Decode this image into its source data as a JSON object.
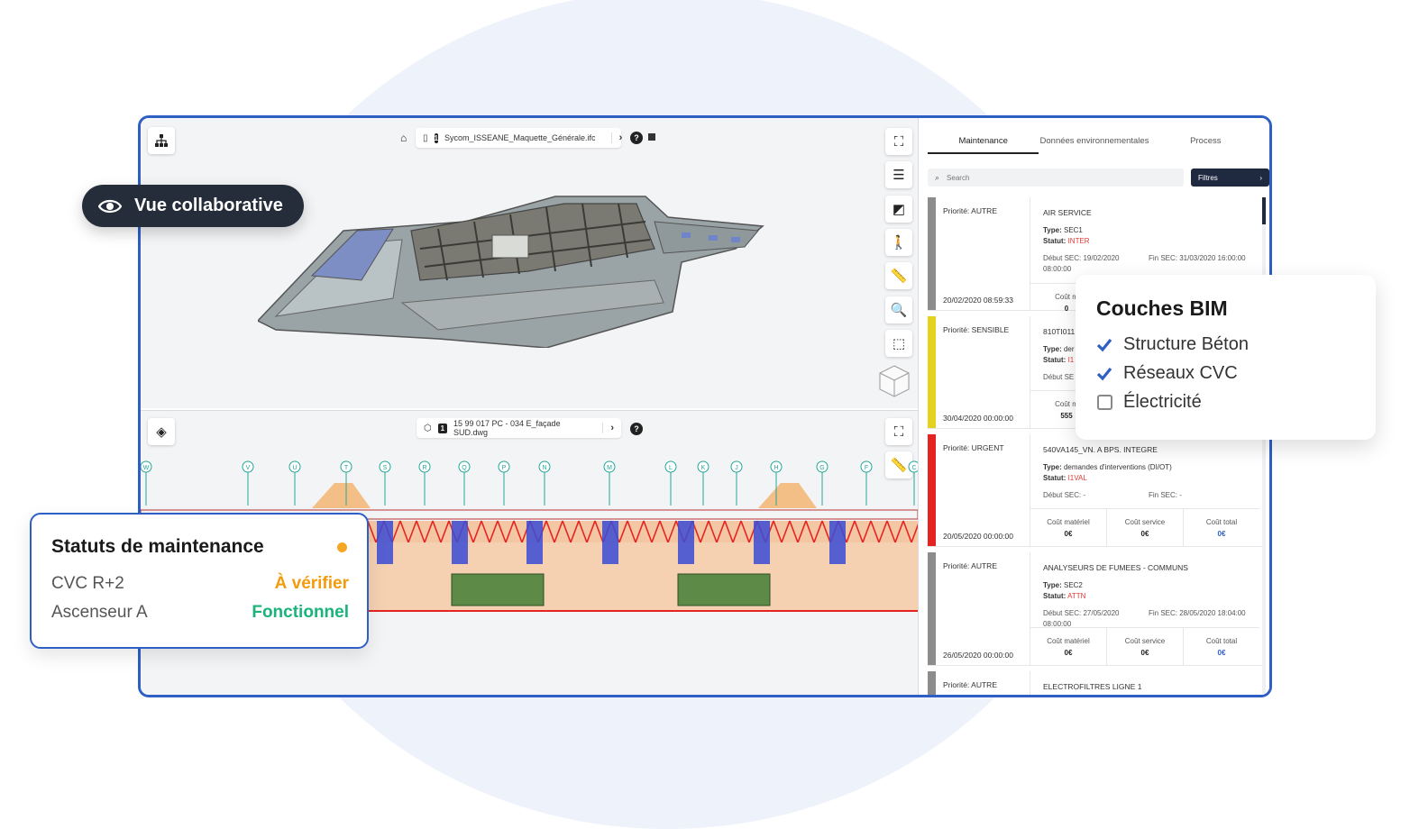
{
  "top_viewer": {
    "file_index": "1",
    "file_name": "Sycom_ISSEANE_Maquette_Générale.ifc",
    "help": "?"
  },
  "bottom_viewer": {
    "file_index": "1",
    "file_name": "15 99 017 PC - 034 E_façade SUD.dwg",
    "help": "?",
    "grid_markers": [
      "W",
      "V",
      "U",
      "T",
      "S",
      "R",
      "Q",
      "P",
      "N",
      "M",
      "L",
      "K",
      "J",
      "H",
      "G",
      "F",
      "C"
    ]
  },
  "tabs": [
    "Maintenance",
    "Données environnementales",
    "Process"
  ],
  "search": {
    "placeholder": "Search"
  },
  "filters_label": "Filtres",
  "cards": [
    {
      "bar_color": "#8c8c8c",
      "priority": "Priorité: AUTRE",
      "date": "20/02/2020 08:59:33",
      "title": "AIR SERVICE",
      "type_label": "Type:",
      "type": "SEC1",
      "status_label": "Statut:",
      "status": "INTER",
      "debut": "Début SEC: 19/02/2020 08:00:00",
      "fin": "Fin SEC: 31/03/2020 16:00:00",
      "cost_mat_label": "Coût m",
      "cost_mat": "0"
    },
    {
      "bar_color": "#e5d21e",
      "priority": "Priorité: SENSIBLE",
      "date": "30/04/2020 00:00:00",
      "title": "810TI011",
      "type_label": "Type:",
      "type": "der",
      "status_label": "Statut:",
      "status": "I1",
      "debut": "Début SE",
      "cost_mat_label": "Coût m",
      "cost_mat": "555"
    },
    {
      "bar_color": "#e52321",
      "priority": "Priorité: URGENT",
      "date": "20/05/2020 00:00:00",
      "title": "540VA145_VN. A BPS. INTEGRE",
      "type_label": "Type:",
      "type": "demandes d'interventions (DI/OT)",
      "status_label": "Statut:",
      "status": "I1VAL",
      "debut": "Début SEC: -",
      "fin": "Fin SEC: -",
      "cost_mat_label": "Coût matériel",
      "cost_mat": "0€",
      "cost_serv_label": "Coût service",
      "cost_serv": "0€",
      "cost_tot_label": "Coût total",
      "cost_tot": "0€"
    },
    {
      "bar_color": "#8c8c8c",
      "priority": "Priorité: AUTRE",
      "date": "26/05/2020 00:00:00",
      "title": "ANALYSEURS DE FUMEES - COMMUNS",
      "type_label": "Type:",
      "type": "SEC2",
      "status_label": "Statut:",
      "status": "ATTN",
      "debut": "Début SEC: 27/05/2020 08:00:00",
      "fin": "Fin SEC: 28/05/2020 18:04:00",
      "cost_mat_label": "Coût matériel",
      "cost_mat": "0€",
      "cost_serv_label": "Coût service",
      "cost_serv": "0€",
      "cost_tot_label": "Coût total",
      "cost_tot": "0€"
    },
    {
      "bar_color": "#8c8c8c",
      "priority": "Priorité: AUTRE",
      "title": "ELECTROFILTRES LIGNE 1"
    }
  ],
  "collab_pill": "Vue collaborative",
  "status_card": {
    "title": "Statuts de maintenance",
    "rows": [
      {
        "label": "CVC R+2",
        "value": "À vérifier"
      },
      {
        "label": "Ascenseur A",
        "value": "Fonctionnel"
      }
    ]
  },
  "layers_card": {
    "title": "Couches BIM",
    "layers": [
      {
        "label": "Structure Béton",
        "checked": true
      },
      {
        "label": "Réseaux CVC",
        "checked": true
      },
      {
        "label": "Électricité",
        "checked": false
      }
    ]
  },
  "colors": {
    "accent": "#2d5fc4",
    "dark": "#252d3b",
    "orange": "#f29b0c",
    "green": "#19b37b",
    "red": "#e53935"
  }
}
